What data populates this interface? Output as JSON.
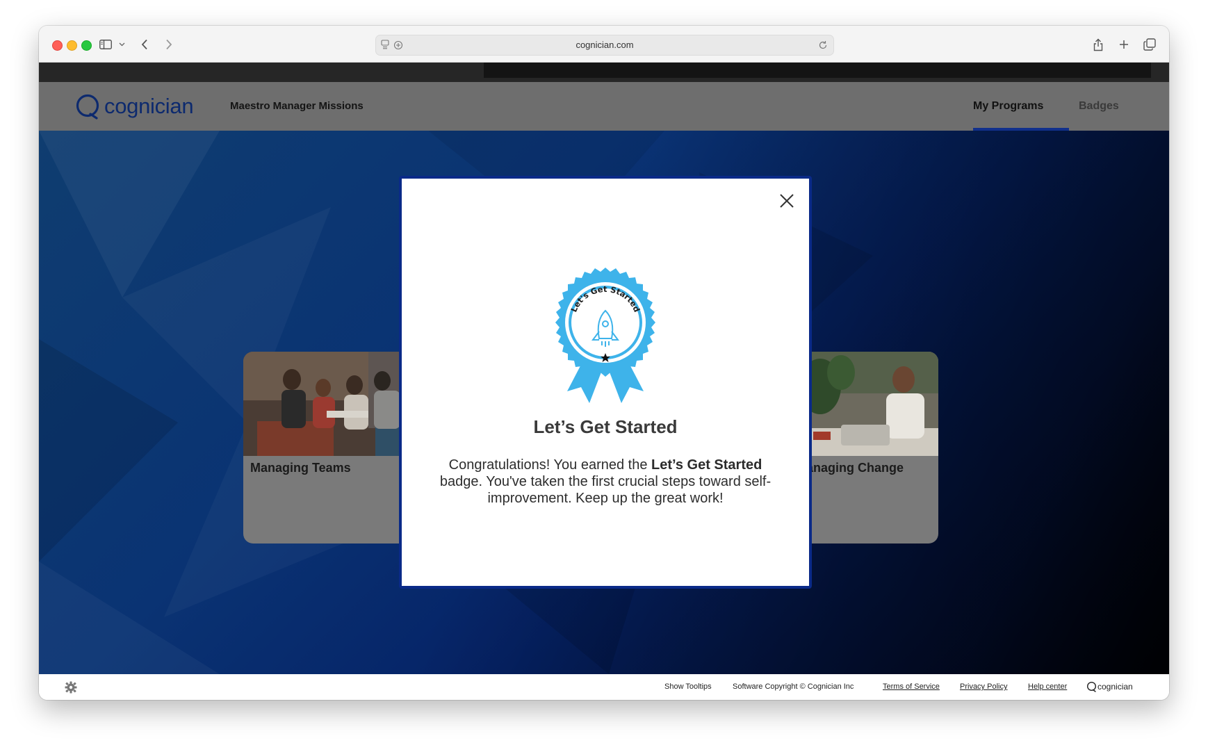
{
  "browser": {
    "url": "cognician.com"
  },
  "site": {
    "logo_text": "cognician",
    "program_title": "Maestro Manager Missions",
    "tabs": [
      {
        "label": "My Programs",
        "active": true
      },
      {
        "label": "Badges",
        "active": false
      }
    ],
    "accent_color": "#11308c"
  },
  "cards": [
    {
      "title": "Managing Teams"
    },
    {
      "title": "Managing Change",
      "visible_title": "anaging Change"
    }
  ],
  "modal": {
    "badge_ribbon_text": "Let's Get Started",
    "title": "Let’s Get Started",
    "body_prefix": "Congratulations! You earned the ",
    "body_bold": "Let’s Get Started",
    "body_suffix": " badge. You've taken the first crucial steps toward self-improvement. Keep up the great work!",
    "badge_color": "#3eb3ea"
  },
  "footer": {
    "show_tooltips": "Show Tooltips",
    "copyright": "Software Copyright © Cognician Inc",
    "terms": "Terms of Service",
    "privacy": "Privacy Policy",
    "help": "Help center",
    "logo_text": "cognician"
  }
}
